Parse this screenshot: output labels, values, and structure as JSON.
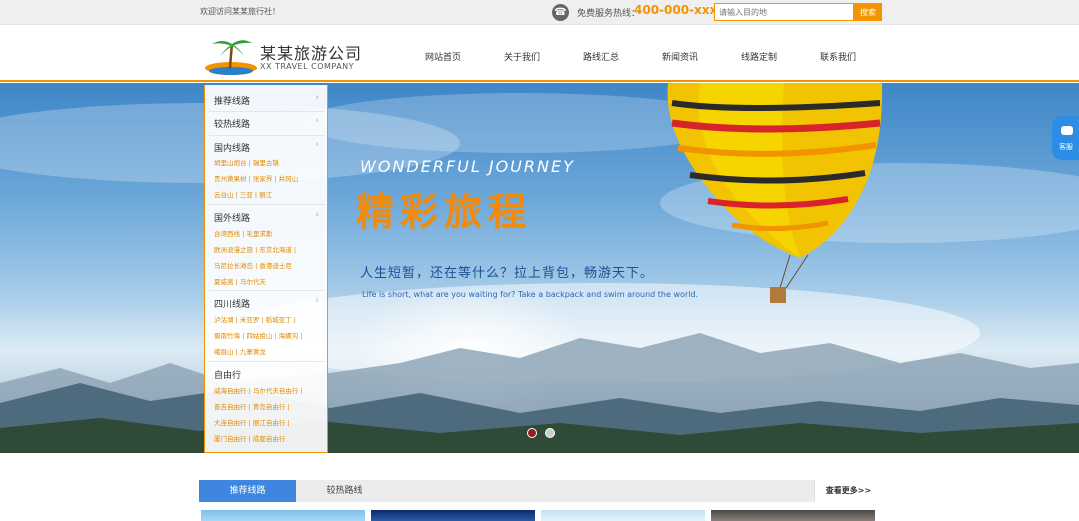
{
  "topbar": {
    "welcome": "欢迎访问某某旅行社！",
    "hotline_label": "免费服务热线：",
    "hotline_number": "400-000-xxx",
    "search_placeholder": "请输入目的地",
    "search_button": "搜索"
  },
  "logo": {
    "name_cn": "某某旅游公司",
    "name_en": "XX TRAVEL COMPANY"
  },
  "nav": [
    "网站首页",
    "关于我们",
    "路线汇总",
    "新闻资讯",
    "线路定制",
    "联系我们"
  ],
  "banner": {
    "headline_en": "WONDERFUL JOURNEY",
    "headline_cn": "精彩旅程",
    "slogan_cn": "人生短暂，还在等什么？拉上背包，畅游天下。",
    "slogan_en": "Life is short, what are you waiting for? Take a backpack and swim around the world.",
    "slide_count": 2,
    "active_slide": 1
  },
  "sidemenu": {
    "simple": [
      "推荐线路",
      "较热线路"
    ],
    "categories": [
      {
        "title": "国内线路",
        "lines": [
          "胡里山炮台 | 瑞里古镇",
          "贵州黄果树 | 张家界 | 井冈山",
          "云台山 | 三亚 | 丽江"
        ]
      },
      {
        "title": "国外线路",
        "lines": [
          "台湾西线 | 毛里求斯",
          "欧洲浪漫之旅 | 东京北海道 |",
          "马尼拉长滩岛 | 香港迪士尼",
          "夏威夷 | 马尔代夫"
        ]
      },
      {
        "title": "四川线路",
        "lines": [
          "泸沽湖 | 米亚罗 | 稻城亚丁 |",
          "蜀南竹海 | 四姑娘山 | 海螺沟 |",
          "峨眉山 | 九寨黄龙"
        ]
      },
      {
        "title": "自由行",
        "lines": [
          "威海自由行 | 马尔代夫自由行 |",
          "普吉自由行 | 青岛自由行 |",
          "大连自由行 | 丽江自由行 |",
          "厦门自由行 | 成都自由行"
        ]
      }
    ]
  },
  "cs_tab": {
    "label": "客服"
  },
  "tabs": {
    "active": "推荐线路",
    "other": "较热路线",
    "more": "查看更多>>"
  },
  "colors": {
    "accent": "#f29400",
    "tab_blue": "#3e86e0",
    "headline_orange": "#f28a0b"
  }
}
